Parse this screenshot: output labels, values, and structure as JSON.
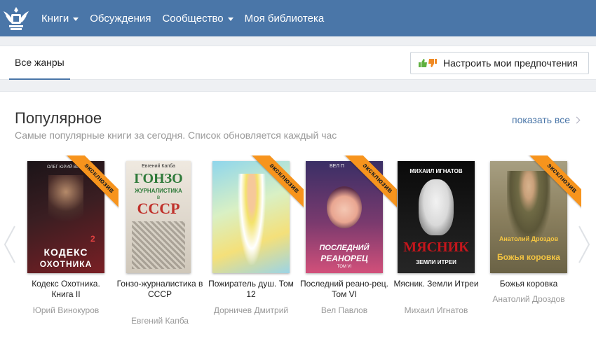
{
  "nav": {
    "items": [
      {
        "label": "Книги",
        "dropdown": true
      },
      {
        "label": "Обсуждения",
        "dropdown": false
      },
      {
        "label": "Сообщество",
        "dropdown": true
      },
      {
        "label": "Моя библиотека",
        "dropdown": false
      }
    ]
  },
  "genres": {
    "active_tab": "Все жанры",
    "preferences_button": "Настроить мои предпочтения"
  },
  "popular": {
    "title": "Популярное",
    "subtitle": "Самые популярные книги за сегодня. Список обновляется каждый час",
    "show_all": "показать все"
  },
  "books": [
    {
      "title": "Кодекс Охотника. Книга II",
      "author": "Юрий Винокуров",
      "exclusive": true,
      "badge": "эксклюзив",
      "cover_text": [
        "КОДЕКС",
        "ОХОТНИКА"
      ],
      "cover_top": "ОЛЕГ ЮРИЙ ВИН",
      "cover_num": "2",
      "cover_colors": [
        "#2a1a1e",
        "#8a2a2a"
      ]
    },
    {
      "title": "Гонзо-журналистика в СССР",
      "author": "Евгений Капба",
      "exclusive": false,
      "badge": "",
      "cover_text": [
        "ГОНЗО",
        "ЖУРНАЛИСТИКА",
        "в",
        "СССР"
      ],
      "cover_top": "Евгений Капба",
      "cover_num": "",
      "cover_colors": [
        "#e9e4dc",
        "#c9c2b6"
      ]
    },
    {
      "title": "Пожиратель душ. Том 12",
      "author": "Дорничев Дмитрий",
      "exclusive": true,
      "badge": "эксклюзив",
      "cover_text": [],
      "cover_top": "",
      "cover_num": "",
      "cover_colors": [
        "#7fd1e8",
        "#f5e38a"
      ]
    },
    {
      "title": "Последний реано-рец. Том VI",
      "author": "Вел Павлов",
      "exclusive": true,
      "badge": "эксклюзив",
      "cover_text": [
        "ПОСЛЕДНИЙ",
        "РЕАНОРЕЦ"
      ],
      "cover_top": "ВЕЛ П",
      "cover_num": "ТОМ VI",
      "cover_colors": [
        "#2b1f4a",
        "#c33b6b"
      ]
    },
    {
      "title": "Мясник. Земли Итреи",
      "author": "Михаил Игнатов",
      "exclusive": false,
      "badge": "",
      "cover_text": [
        "МЯСНИК",
        "ЗЕМЛИ ИТРЕИ"
      ],
      "cover_top": "МИХАИЛ ИГНАТОВ",
      "cover_num": "",
      "cover_colors": [
        "#0d0d0d",
        "#3a3a3a"
      ]
    },
    {
      "title": "Божья коровка",
      "author": "Анатолий Дроздов",
      "exclusive": true,
      "badge": "эксклюзив",
      "cover_text": [
        "Анатолий Дроздов",
        "Божья коровка"
      ],
      "cover_top": "",
      "cover_num": "",
      "cover_colors": [
        "#8c8266",
        "#c9bd95"
      ]
    }
  ],
  "icons": {
    "logo": "eagle-crest-icon",
    "thumb_up": "thumb-up-icon",
    "thumb_down": "thumb-down-icon",
    "prev": "chevron-left-icon",
    "next": "chevron-right-icon"
  },
  "colors": {
    "nav_bg": "#4a76a8",
    "accent": "#4a76a8",
    "badge": "#f7941d",
    "muted": "#999999"
  }
}
